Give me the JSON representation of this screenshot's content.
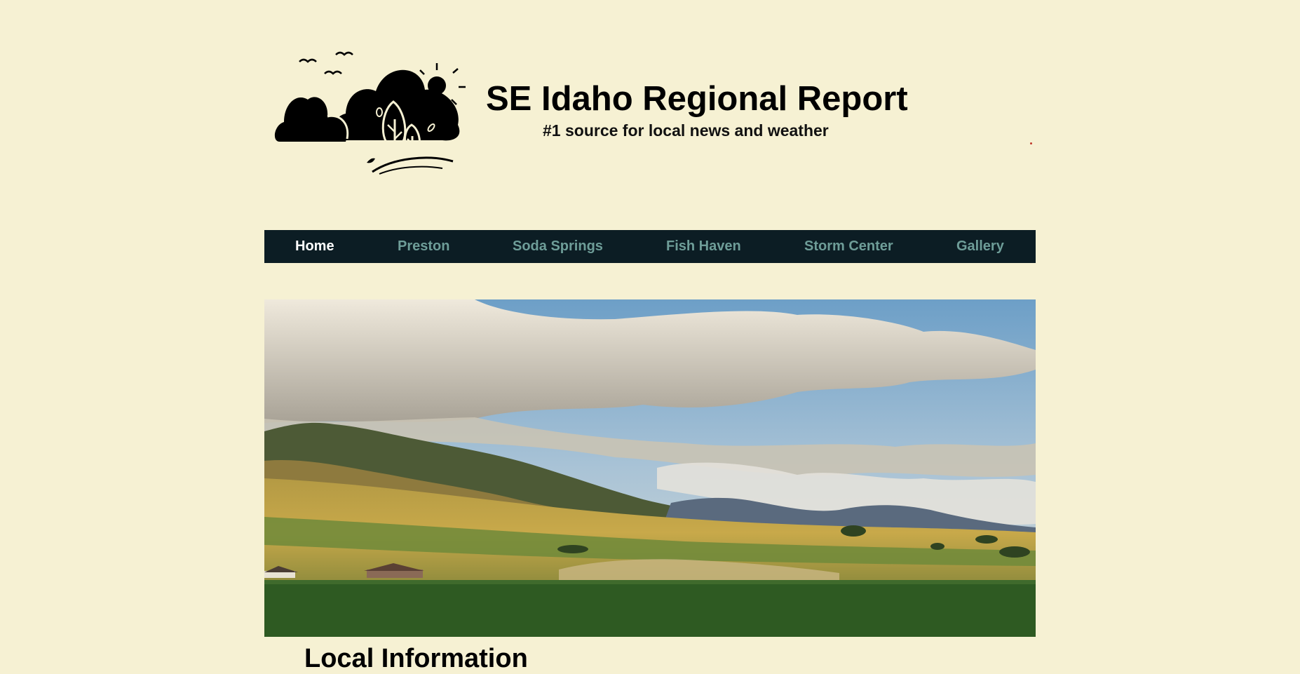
{
  "site": {
    "title": "SE Idaho Regional Report",
    "tagline": "#1 source for local news and weather"
  },
  "logo": {
    "icon": "landscape-logo-icon"
  },
  "nav": {
    "items": [
      {
        "label": "Home",
        "active": true
      },
      {
        "label": "Preston",
        "active": false
      },
      {
        "label": "Soda Springs",
        "active": false
      },
      {
        "label": "Fish Haven",
        "active": false
      },
      {
        "label": "Storm Center",
        "active": false
      },
      {
        "label": "Gallery",
        "active": false
      }
    ]
  },
  "hero": {
    "subject": "mountain-valley-landscape"
  },
  "main": {
    "section_heading": "Local Information"
  },
  "colors": {
    "page_background": "#f6f1d3",
    "nav_background": "#0c1d24",
    "nav_link": "#6e9d98",
    "nav_active": "#ffffff"
  }
}
